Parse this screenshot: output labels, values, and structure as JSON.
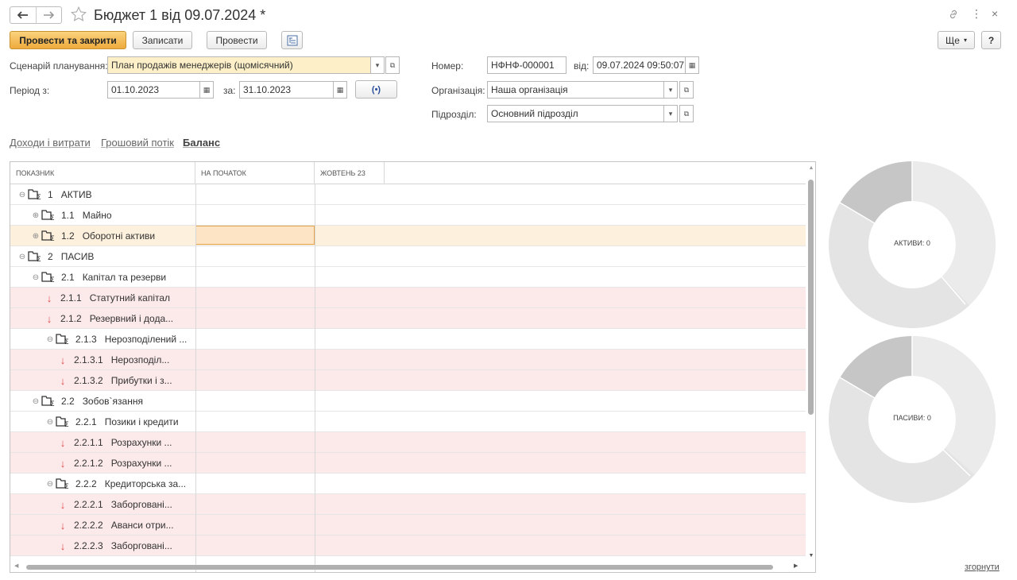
{
  "window": {
    "title": "Бюджет 1 від 09.07.2024 *",
    "back_icon": "arrow-left-icon",
    "forward_icon": "arrow-right-icon",
    "star_icon": "star-icon"
  },
  "toolbar": {
    "post_close": "Провести та закрити",
    "save": "Записати",
    "post": "Провести",
    "more": "Ще",
    "help": "?"
  },
  "form": {
    "scenario_label": "Сценарій планування:",
    "scenario_value": "План продажів менеджерів (щомісячний)",
    "period_label": "Період з:",
    "period_from": "01.10.2023",
    "period_to_label": "за:",
    "period_to": "31.10.2023",
    "period_btn": "(•)",
    "number_label": "Номер:",
    "number_value": "НФНФ-000001",
    "date_label": "від:",
    "date_value": "09.07.2024 09:50:07",
    "org_label": "Організація:",
    "org_value": "Наша організація",
    "dept_label": "Підрозділ:",
    "dept_value": "Основний підрозділ"
  },
  "tabs": [
    "Доходи і витрати",
    "Грошовий потік",
    "Баланс"
  ],
  "grid": {
    "headers": [
      "ПОКАЗНИК",
      "НА ПОЧАТОК",
      "ЖОВТЕНЬ 23"
    ],
    "rows": [
      {
        "level": 0,
        "type": "group",
        "open": true,
        "num": "1",
        "name": "АКТИВ"
      },
      {
        "level": 1,
        "type": "group",
        "open": false,
        "num": "1.1",
        "name": "Майно"
      },
      {
        "level": 1,
        "type": "group",
        "open": false,
        "num": "1.2",
        "name": "Оборотні активи",
        "selected": true
      },
      {
        "level": 0,
        "type": "group",
        "open": true,
        "num": "2",
        "name": "ПАСИВ"
      },
      {
        "level": 1,
        "type": "group",
        "open": true,
        "num": "2.1",
        "name": "Капітал та резерви"
      },
      {
        "level": 2,
        "type": "item",
        "num": "2.1.1",
        "name": "Статутний капітал"
      },
      {
        "level": 2,
        "type": "item",
        "num": "2.1.2",
        "name": "Резервний і дода..."
      },
      {
        "level": 2,
        "type": "group",
        "open": true,
        "num": "2.1.3",
        "name": "Нерозподілений ..."
      },
      {
        "level": 3,
        "type": "item",
        "num": "2.1.3.1",
        "name": "Нерозподіл..."
      },
      {
        "level": 3,
        "type": "item",
        "num": "2.1.3.2",
        "name": "Прибутки і з..."
      },
      {
        "level": 1,
        "type": "group",
        "open": true,
        "num": "2.2",
        "name": "Зобов`язання"
      },
      {
        "level": 2,
        "type": "group",
        "open": true,
        "num": "2.2.1",
        "name": "Позики і кредити"
      },
      {
        "level": 3,
        "type": "item",
        "num": "2.2.1.1",
        "name": "Розрахунки ..."
      },
      {
        "level": 3,
        "type": "item",
        "num": "2.2.1.2",
        "name": "Розрахунки ..."
      },
      {
        "level": 2,
        "type": "group",
        "open": true,
        "num": "2.2.2",
        "name": "Кредиторська за..."
      },
      {
        "level": 3,
        "type": "item",
        "num": "2.2.2.1",
        "name": "Заборговані..."
      },
      {
        "level": 3,
        "type": "item",
        "num": "2.2.2.2",
        "name": "Аванси отри..."
      },
      {
        "level": 3,
        "type": "item",
        "num": "2.2.2.3",
        "name": "Заборговані..."
      }
    ]
  },
  "charts": {
    "assets_label": "АКТИВИ: 0",
    "liabilities_label": "ПАСИВИ: 0"
  },
  "collapse_link": "згорнути",
  "colors": {
    "accent": "#eeaa3d",
    "pink_row": "#fce9ea",
    "selected_row": "#fdf0dd",
    "donut_light": "#e4e4e4",
    "donut_dark": "#c6c6c6"
  }
}
